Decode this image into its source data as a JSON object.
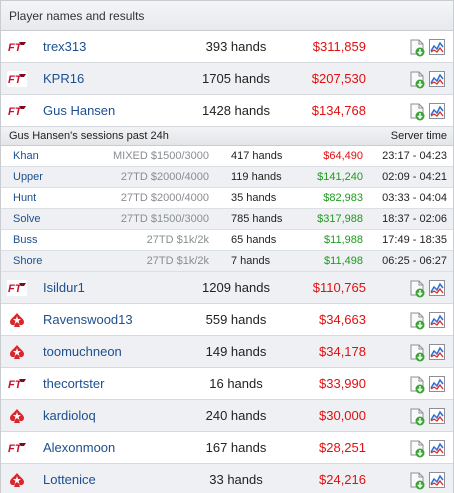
{
  "header": {
    "title": "Player names and results"
  },
  "colors": {
    "loss": "#e01010",
    "win": "#1f9a1f",
    "link": "#1d4f8f"
  },
  "players_top": [
    {
      "site_icon": "full-tilt-icon",
      "name": "trex313",
      "hands": "393 hands",
      "amount": "$311,859"
    },
    {
      "site_icon": "full-tilt-icon",
      "name": "KPR16",
      "hands": "1705 hands",
      "amount": "$207,530"
    },
    {
      "site_icon": "full-tilt-icon",
      "name": "Gus Hansen",
      "hands": "1428 hands",
      "amount": "$134,768"
    }
  ],
  "sessions": {
    "title": "Gus Hansen's sessions past 24h",
    "server_time_label": "Server time",
    "rows": [
      {
        "opponent": "Khan",
        "game": "MIXED $1500/3000",
        "hands": "417 hands",
        "amount": "$64,490",
        "result": "loss",
        "time": "23:17 - 04:23"
      },
      {
        "opponent": "Upper",
        "game": "27TD $2000/4000",
        "hands": "119 hands",
        "amount": "$141,240",
        "result": "win",
        "time": "02:09 - 04:21"
      },
      {
        "opponent": "Hunt",
        "game": "27TD $2000/4000",
        "hands": "35 hands",
        "amount": "$82,983",
        "result": "win",
        "time": "03:33 - 04:04"
      },
      {
        "opponent": "Solve",
        "game": "27TD $1500/3000",
        "hands": "785 hands",
        "amount": "$317,988",
        "result": "win",
        "time": "18:37 - 02:06"
      },
      {
        "opponent": "Buss",
        "game": "27TD $1k/2k",
        "hands": "65 hands",
        "amount": "$11,988",
        "result": "win",
        "time": "17:49 - 18:35"
      },
      {
        "opponent": "Shore",
        "game": "27TD $1k/2k",
        "hands": "7 hands",
        "amount": "$11,498",
        "result": "win",
        "time": "06:25 - 06:27"
      }
    ]
  },
  "players_bottom": [
    {
      "site_icon": "full-tilt-icon",
      "name": "Isildur1",
      "hands": "1209 hands",
      "amount": "$110,765"
    },
    {
      "site_icon": "pokerstars-icon",
      "name": "Ravenswood13",
      "hands": "559 hands",
      "amount": "$34,663"
    },
    {
      "site_icon": "pokerstars-icon",
      "name": "toomuchneon",
      "hands": "149 hands",
      "amount": "$34,178"
    },
    {
      "site_icon": "full-tilt-icon",
      "name": "thecortster",
      "hands": "16 hands",
      "amount": "$33,990"
    },
    {
      "site_icon": "pokerstars-icon",
      "name": "kardioloq",
      "hands": "240 hands",
      "amount": "$30,000"
    },
    {
      "site_icon": "full-tilt-icon",
      "name": "Alexonmoon",
      "hands": "167 hands",
      "amount": "$28,251"
    },
    {
      "site_icon": "pokerstars-icon",
      "name": "Lottenice",
      "hands": "33 hands",
      "amount": "$24,216"
    }
  ]
}
